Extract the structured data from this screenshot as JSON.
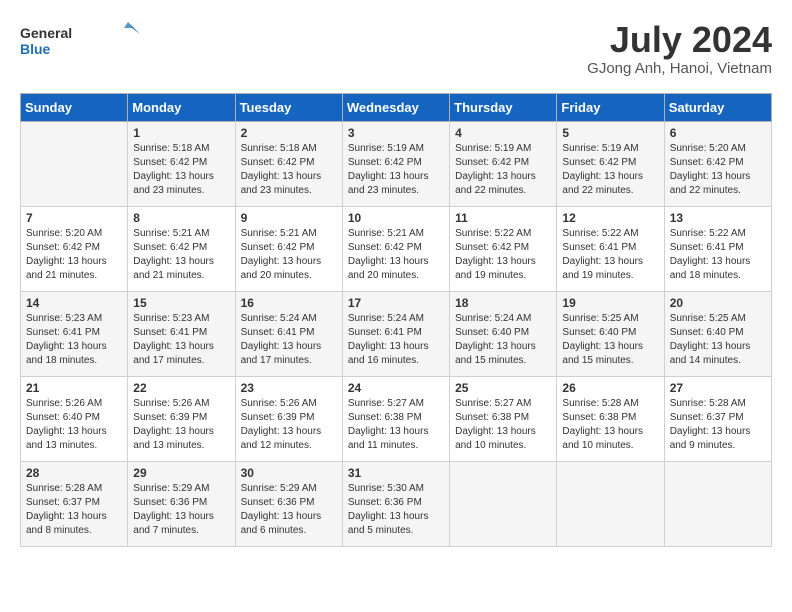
{
  "header": {
    "logo_line1": "General",
    "logo_line2": "Blue",
    "month_year": "July 2024",
    "location": "GJong Anh, Hanoi, Vietnam"
  },
  "days_of_week": [
    "Sunday",
    "Monday",
    "Tuesday",
    "Wednesday",
    "Thursday",
    "Friday",
    "Saturday"
  ],
  "weeks": [
    [
      {
        "day": "",
        "info": ""
      },
      {
        "day": "1",
        "info": "Sunrise: 5:18 AM\nSunset: 6:42 PM\nDaylight: 13 hours\nand 23 minutes."
      },
      {
        "day": "2",
        "info": "Sunrise: 5:18 AM\nSunset: 6:42 PM\nDaylight: 13 hours\nand 23 minutes."
      },
      {
        "day": "3",
        "info": "Sunrise: 5:19 AM\nSunset: 6:42 PM\nDaylight: 13 hours\nand 23 minutes."
      },
      {
        "day": "4",
        "info": "Sunrise: 5:19 AM\nSunset: 6:42 PM\nDaylight: 13 hours\nand 22 minutes."
      },
      {
        "day": "5",
        "info": "Sunrise: 5:19 AM\nSunset: 6:42 PM\nDaylight: 13 hours\nand 22 minutes."
      },
      {
        "day": "6",
        "info": "Sunrise: 5:20 AM\nSunset: 6:42 PM\nDaylight: 13 hours\nand 22 minutes."
      }
    ],
    [
      {
        "day": "7",
        "info": "Sunrise: 5:20 AM\nSunset: 6:42 PM\nDaylight: 13 hours\nand 21 minutes."
      },
      {
        "day": "8",
        "info": "Sunrise: 5:21 AM\nSunset: 6:42 PM\nDaylight: 13 hours\nand 21 minutes."
      },
      {
        "day": "9",
        "info": "Sunrise: 5:21 AM\nSunset: 6:42 PM\nDaylight: 13 hours\nand 20 minutes."
      },
      {
        "day": "10",
        "info": "Sunrise: 5:21 AM\nSunset: 6:42 PM\nDaylight: 13 hours\nand 20 minutes."
      },
      {
        "day": "11",
        "info": "Sunrise: 5:22 AM\nSunset: 6:42 PM\nDaylight: 13 hours\nand 19 minutes."
      },
      {
        "day": "12",
        "info": "Sunrise: 5:22 AM\nSunset: 6:41 PM\nDaylight: 13 hours\nand 19 minutes."
      },
      {
        "day": "13",
        "info": "Sunrise: 5:22 AM\nSunset: 6:41 PM\nDaylight: 13 hours\nand 18 minutes."
      }
    ],
    [
      {
        "day": "14",
        "info": "Sunrise: 5:23 AM\nSunset: 6:41 PM\nDaylight: 13 hours\nand 18 minutes."
      },
      {
        "day": "15",
        "info": "Sunrise: 5:23 AM\nSunset: 6:41 PM\nDaylight: 13 hours\nand 17 minutes."
      },
      {
        "day": "16",
        "info": "Sunrise: 5:24 AM\nSunset: 6:41 PM\nDaylight: 13 hours\nand 17 minutes."
      },
      {
        "day": "17",
        "info": "Sunrise: 5:24 AM\nSunset: 6:41 PM\nDaylight: 13 hours\nand 16 minutes."
      },
      {
        "day": "18",
        "info": "Sunrise: 5:24 AM\nSunset: 6:40 PM\nDaylight: 13 hours\nand 15 minutes."
      },
      {
        "day": "19",
        "info": "Sunrise: 5:25 AM\nSunset: 6:40 PM\nDaylight: 13 hours\nand 15 minutes."
      },
      {
        "day": "20",
        "info": "Sunrise: 5:25 AM\nSunset: 6:40 PM\nDaylight: 13 hours\nand 14 minutes."
      }
    ],
    [
      {
        "day": "21",
        "info": "Sunrise: 5:26 AM\nSunset: 6:40 PM\nDaylight: 13 hours\nand 13 minutes."
      },
      {
        "day": "22",
        "info": "Sunrise: 5:26 AM\nSunset: 6:39 PM\nDaylight: 13 hours\nand 13 minutes."
      },
      {
        "day": "23",
        "info": "Sunrise: 5:26 AM\nSunset: 6:39 PM\nDaylight: 13 hours\nand 12 minutes."
      },
      {
        "day": "24",
        "info": "Sunrise: 5:27 AM\nSunset: 6:38 PM\nDaylight: 13 hours\nand 11 minutes."
      },
      {
        "day": "25",
        "info": "Sunrise: 5:27 AM\nSunset: 6:38 PM\nDaylight: 13 hours\nand 10 minutes."
      },
      {
        "day": "26",
        "info": "Sunrise: 5:28 AM\nSunset: 6:38 PM\nDaylight: 13 hours\nand 10 minutes."
      },
      {
        "day": "27",
        "info": "Sunrise: 5:28 AM\nSunset: 6:37 PM\nDaylight: 13 hours\nand 9 minutes."
      }
    ],
    [
      {
        "day": "28",
        "info": "Sunrise: 5:28 AM\nSunset: 6:37 PM\nDaylight: 13 hours\nand 8 minutes."
      },
      {
        "day": "29",
        "info": "Sunrise: 5:29 AM\nSunset: 6:36 PM\nDaylight: 13 hours\nand 7 minutes."
      },
      {
        "day": "30",
        "info": "Sunrise: 5:29 AM\nSunset: 6:36 PM\nDaylight: 13 hours\nand 6 minutes."
      },
      {
        "day": "31",
        "info": "Sunrise: 5:30 AM\nSunset: 6:36 PM\nDaylight: 13 hours\nand 5 minutes."
      },
      {
        "day": "",
        "info": ""
      },
      {
        "day": "",
        "info": ""
      },
      {
        "day": "",
        "info": ""
      }
    ]
  ]
}
